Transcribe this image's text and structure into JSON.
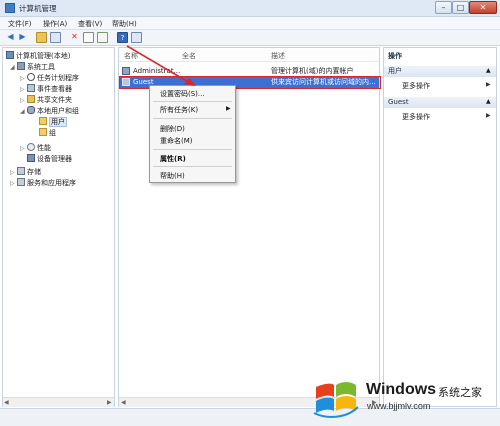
{
  "window": {
    "title": "计算机管理",
    "minimize": "–",
    "maximize": "□",
    "close": "✕"
  },
  "menu": [
    "文件(F)",
    "操作(A)",
    "查看(V)",
    "帮助(H)"
  ],
  "tree": [
    {
      "label": "计算机管理(本地)",
      "icon": "computer-icon",
      "expander": ""
    },
    {
      "label": "系统工具",
      "icon": "tools-icon",
      "expander": "◢"
    },
    {
      "label": "任务计划程序",
      "icon": "clock-icon",
      "expander": "▷"
    },
    {
      "label": "事件查看器",
      "icon": "event-viewer-icon",
      "expander": "▷"
    },
    {
      "label": "共享文件夹",
      "icon": "folder-share-icon",
      "expander": "▷"
    },
    {
      "label": "本地用户和组",
      "icon": "users-icon",
      "expander": "◢"
    },
    {
      "label": "用户",
      "icon": "folder-icon",
      "expander": ""
    },
    {
      "label": "组",
      "icon": "folder-icon",
      "expander": ""
    },
    {
      "label": "性能",
      "icon": "performance-icon",
      "expander": "▷"
    },
    {
      "label": "设备管理器",
      "icon": "device-manager-icon",
      "expander": ""
    },
    {
      "label": "存储",
      "icon": "storage-icon",
      "expander": "▷"
    },
    {
      "label": "服务和应用程序",
      "icon": "services-icon",
      "expander": "▷"
    }
  ],
  "list": {
    "headers": [
      "名称",
      "全名",
      "描述"
    ],
    "rows": [
      {
        "name": "Administrat...",
        "fullname": "",
        "desc": "管理计算机(域)的内置帐户"
      },
      {
        "name": "Guest",
        "fullname": "",
        "desc": "供来宾访问计算机或访问域的内..."
      }
    ]
  },
  "context_menu": [
    "设置密码(S)...",
    "所有任务(K)",
    "删除(D)",
    "重命名(M)",
    "属性(R)",
    "帮助(H)"
  ],
  "actions": {
    "header": "操作",
    "group1": "用户",
    "group1_item": "更多操作",
    "group2": "Guest",
    "group2_item": "更多操作"
  },
  "watermark": {
    "brand": "Windows",
    "tagline": "系统之家",
    "url": "www.bjjmlv.com"
  },
  "colors": {
    "selection": "#3e6fd3",
    "arrow": "#d9262b"
  }
}
